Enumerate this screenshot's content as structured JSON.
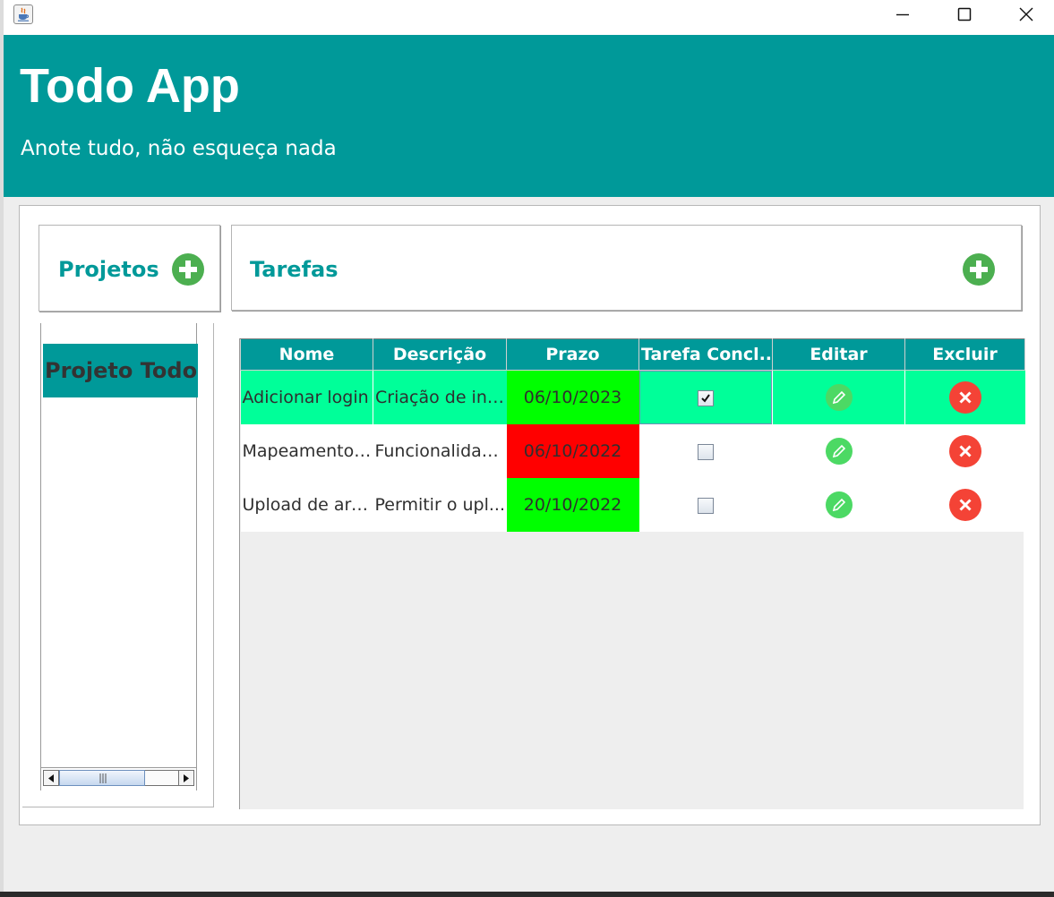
{
  "window": {
    "app_icon": "java-cup-icon",
    "controls": [
      "minimize-icon",
      "maximize-icon",
      "close-icon"
    ]
  },
  "header": {
    "title": "Todo App",
    "subtitle": "Anote tudo, não esqueça nada",
    "color": "#009999"
  },
  "projects": {
    "title": "Projetos",
    "add_icon": "plus-circle-icon",
    "items": [
      {
        "label": "Projeto Todo",
        "selected": true
      }
    ]
  },
  "tasks": {
    "title": "Tarefas",
    "add_icon": "plus-circle-icon",
    "columns": [
      "Nome",
      "Descrição",
      "Prazo",
      "Tarefa Concl...",
      "Editar",
      "Excluir"
    ],
    "rows": [
      {
        "name": "Adicionar login",
        "description": "Criação de int...",
        "deadline": "06/10/2023",
        "deadline_color": "#00ff00",
        "completed": true,
        "selected": true
      },
      {
        "name": "Mapeamento ...",
        "description": "Funcionalidad...",
        "deadline": "06/10/2022",
        "deadline_color": "#ff0000",
        "completed": false,
        "selected": false
      },
      {
        "name": "Upload de arq...",
        "description": "Permitir o upl...",
        "deadline": "20/10/2022",
        "deadline_color": "#00ff00",
        "completed": false,
        "selected": false
      }
    ],
    "edit_icon": "pencil-icon",
    "delete_icon": "x-circle-icon",
    "selected_row_color": "#00ff99"
  }
}
